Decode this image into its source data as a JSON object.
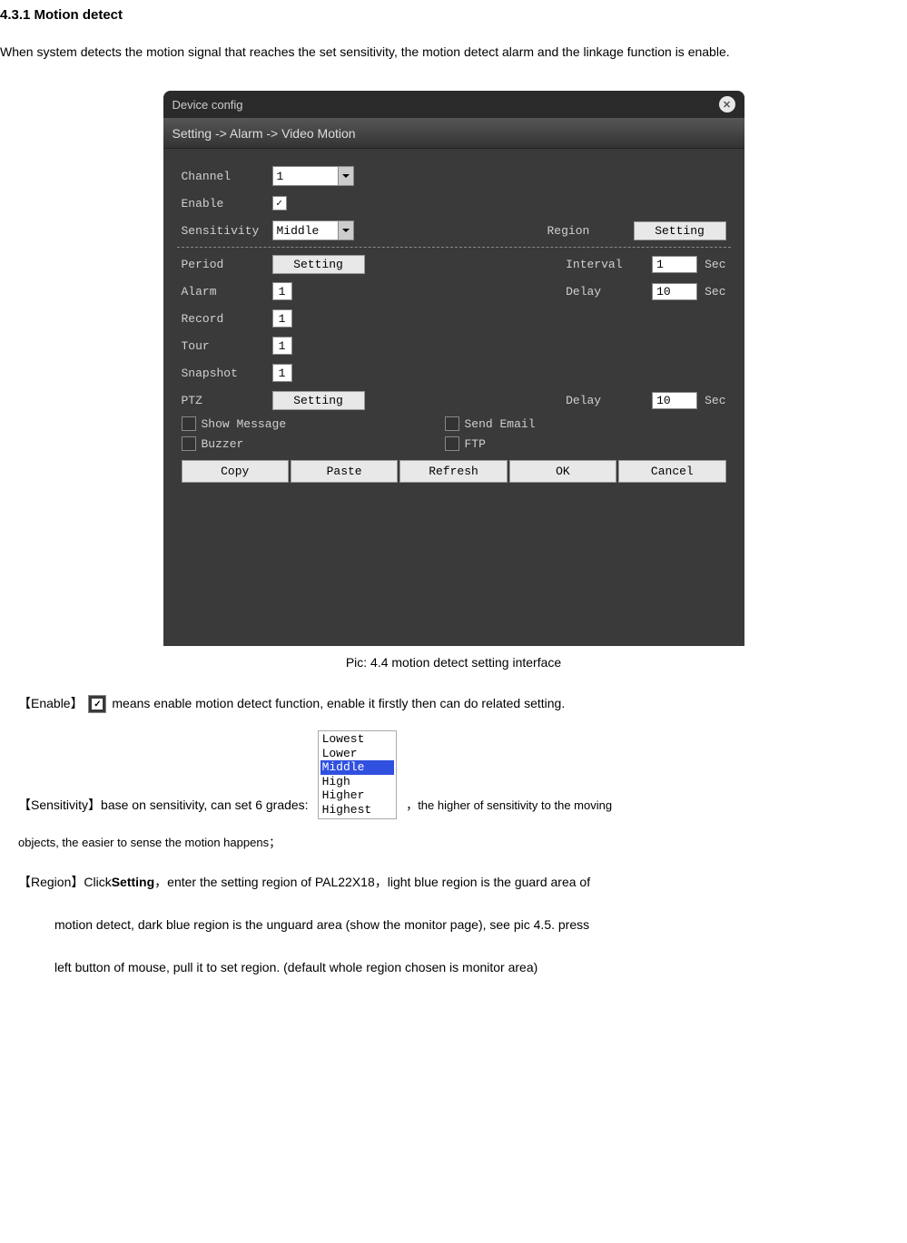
{
  "heading": "4.3.1 Motion detect",
  "intro": "When system detects the motion signal that reaches the set sensitivity, the motion detect alarm and the linkage function is enable.",
  "dialog": {
    "title": "Device config",
    "breadcrumb": "Setting -> Alarm -> Video Motion",
    "labels": {
      "channel": "Channel",
      "enable": "Enable",
      "sensitivity": "Sensitivity",
      "region": "Region",
      "period": "Period",
      "interval": "Interval",
      "alarm": "Alarm",
      "delay1": "Delay",
      "record": "Record",
      "tour": "Tour",
      "snapshot": "Snapshot",
      "ptz": "PTZ",
      "delay2": "Delay",
      "show_message": "Show Message",
      "send_email": "Send Email",
      "buzzer": "Buzzer",
      "ftp": "FTP"
    },
    "values": {
      "channel": "1",
      "sensitivity": "Middle",
      "region_btn": "Setting",
      "period_btn": "Setting",
      "interval": "1",
      "interval_unit": "Sec",
      "alarm": "1",
      "delay1": "10",
      "delay1_unit": "Sec",
      "record": "1",
      "tour": "1",
      "snapshot": "1",
      "ptz_btn": "Setting",
      "delay2": "10",
      "delay2_unit": "Sec"
    },
    "buttons": {
      "copy": "Copy",
      "paste": "Paste",
      "refresh": "Refresh",
      "ok": "OK",
      "cancel": "Cancel"
    }
  },
  "caption": "Pic: 4.4 motion detect setting interface",
  "desc": {
    "enable_label": "【Enable】",
    "enable_text": "means enable motion detect function, enable it firstly then can do related setting.",
    "sens_label": "【Sensitivity】",
    "sens_text1": "base on sensitivity, can set 6 grades:",
    "sens_text2": "，the higher of sensitivity to the moving",
    "sens_text3": "objects, the easier to sense the motion happens；",
    "sens_options": [
      "Lowest",
      "Lower",
      "Middle",
      "High",
      "Higher",
      "Highest"
    ],
    "region_label": "【Region】",
    "region_text1a": "Click",
    "region_text1b": "Setting",
    "region_text1c": "，enter the setting region of PAL22X18，light blue region is the guard area of",
    "region_text2": "motion detect, dark blue region is the unguard area (show the monitor page), see pic 4.5. press",
    "region_text3": "left button of mouse, pull it to set region. (default whole region chosen is monitor area)"
  }
}
